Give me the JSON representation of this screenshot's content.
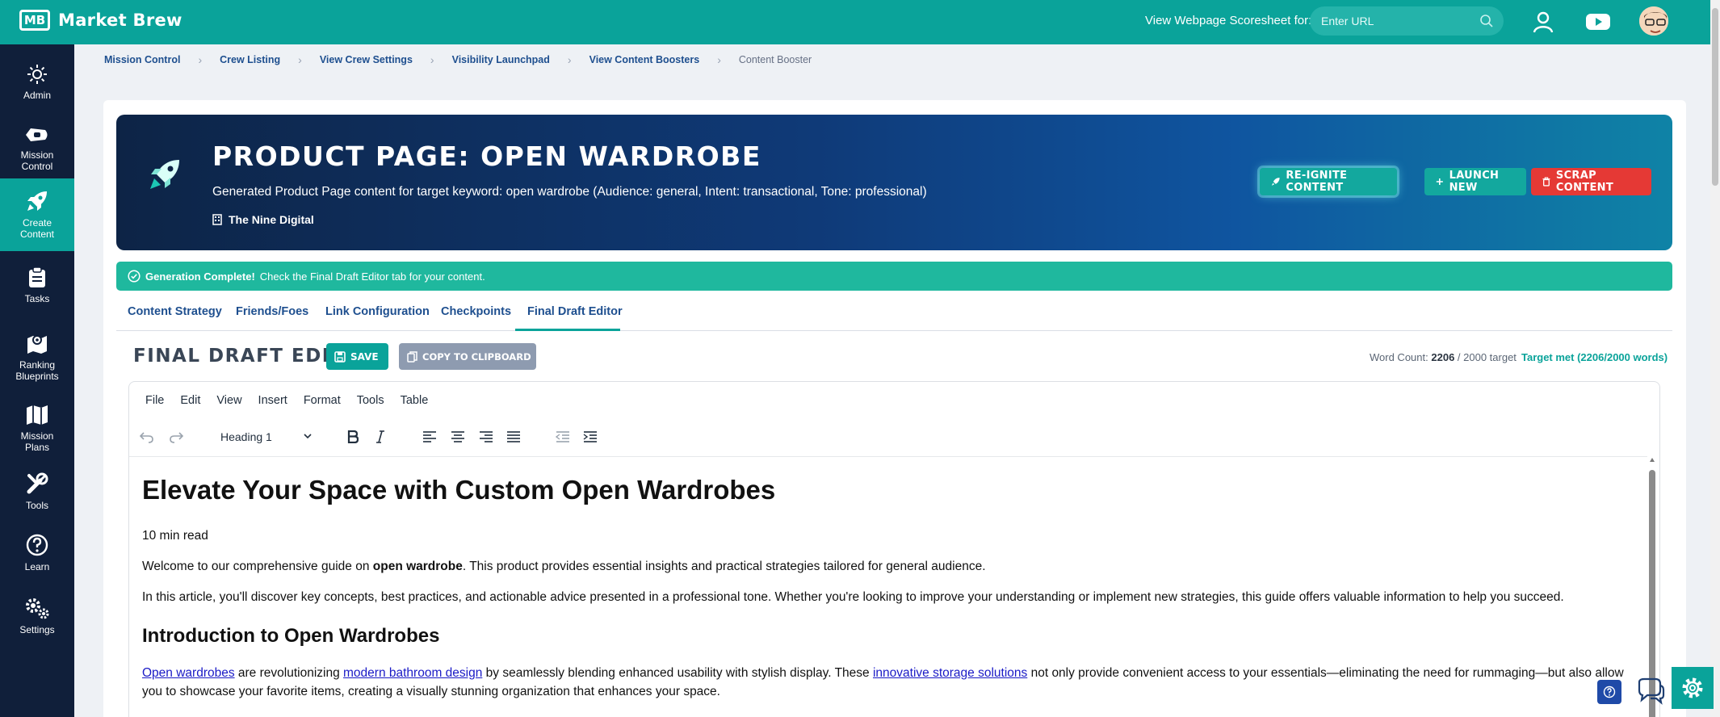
{
  "app": {
    "brand_mark": "MB",
    "brand_name": "Market Brew",
    "scoresheet_label": "View Webpage Scoresheet for:",
    "url_placeholder": "Enter URL"
  },
  "sidebar": {
    "items": [
      {
        "label": "Admin",
        "icon": "sun-icon"
      },
      {
        "label": "Mission Control",
        "icon": "spaceship-icon"
      },
      {
        "label": "Create Content",
        "icon": "rocket-icon",
        "active": true
      },
      {
        "label": "Tasks",
        "icon": "clipboard-icon"
      },
      {
        "label": "Ranking Blueprints",
        "icon": "map-pin-icon"
      },
      {
        "label": "Mission Plans",
        "icon": "map-icon"
      },
      {
        "label": "Tools",
        "icon": "tools-icon"
      },
      {
        "label": "Learn",
        "icon": "question-icon"
      },
      {
        "label": "Settings",
        "icon": "gears-icon"
      }
    ]
  },
  "breadcrumb": [
    "Mission Control",
    "Crew Listing",
    "View Crew Settings",
    "Visibility Launchpad",
    "View Content Boosters",
    "Content Booster"
  ],
  "hero": {
    "title": "Product Page: Open Wardrobe",
    "subtitle": "Generated Product Page content for target keyword: open wardrobe (Audience: general, Intent: transactional, Tone: professional)",
    "organization": "The Nine Digital",
    "reignite_label": "Re-Ignite Content",
    "launch_label": "Launch New",
    "scrap_label": "Scrap Content"
  },
  "alert": {
    "strong": "Generation Complete!",
    "text": "Check the Final Draft Editor tab for your content."
  },
  "tabs": [
    "Content Strategy",
    "Friends/Foes",
    "Link Configuration",
    "Checkpoints",
    "Final Draft Editor"
  ],
  "active_tab": "Final Draft Editor",
  "editor_header": {
    "title": "Final Draft Editor",
    "save_label": "Save",
    "copy_label": "Copy to Clipboard",
    "wordcount_label": "Word Count:",
    "wordcount_value": "2206",
    "wordcount_target": "/ 2000 target",
    "target_status": "Target met (2206/2000 words)"
  },
  "editor": {
    "menu": [
      "File",
      "Edit",
      "View",
      "Insert",
      "Format",
      "Tools",
      "Table"
    ],
    "block_format": "Heading 1",
    "content": {
      "h1": "Elevate Your Space with Custom Open Wardrobes",
      "read_time": "10 min read",
      "p1_pre": "Welcome to our comprehensive guide on ",
      "p1_bold": "open wardrobe",
      "p1_post": ". This product provides essential insights and practical strategies tailored for general audience.",
      "p2": "In this article, you'll discover key concepts, best practices, and actionable advice presented in a professional tone. Whether you're looking to improve your understanding or implement new strategies, this guide offers valuable information to help you succeed.",
      "h2": "Introduction to Open Wardrobes",
      "p3_link1": "Open wardrobes",
      "p3_a": " are revolutionizing ",
      "p3_link2": "modern bathroom design",
      "p3_b": " by seamlessly blending enhanced usability with stylish display. These ",
      "p3_link3": "innovative storage solutions",
      "p3_c": " not only provide convenient access to your essentials—eliminating the need for rummaging—but also allow you to showcase your favorite items, creating a visually stunning organization that enhances your space."
    }
  },
  "colors": {
    "teal": "#0aa39a",
    "navy": "#101f3a",
    "danger": "#e53935",
    "link": "#1e4f8f"
  }
}
